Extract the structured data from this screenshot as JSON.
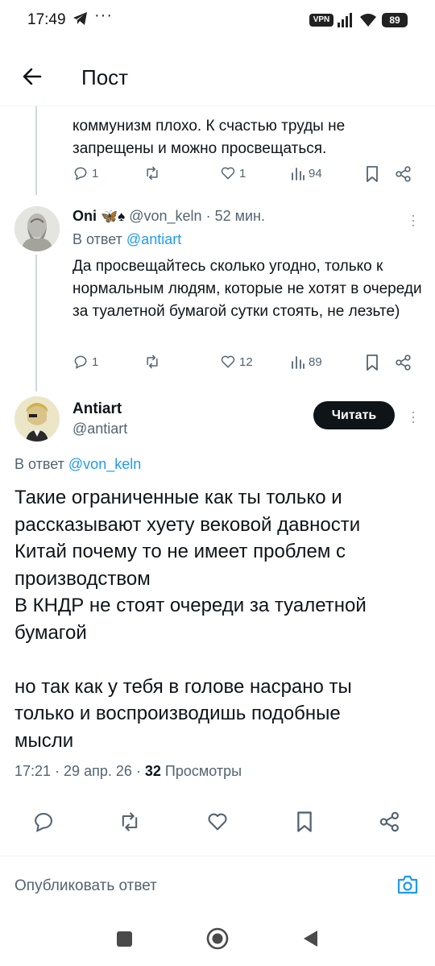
{
  "status_bar": {
    "time": "17:49",
    "dots": "···",
    "vpn": "VPN",
    "battery": "89"
  },
  "header": {
    "title": "Пост"
  },
  "top_tweet": {
    "text_line1": "коммунизм плохо. К счастью труды не",
    "text_line2": "запрещены и можно просвещаться.",
    "replies": "1",
    "likes": "1",
    "views": "94"
  },
  "reply_tweet": {
    "display_name": "Oni",
    "emoji": "🦋♠",
    "handle": "@von_keln",
    "time": "· 52 мин.",
    "reply_to_label": "В ответ",
    "reply_to_handle": "@antiart",
    "text": "Да просвещайтесь сколько угодно, только к нормальным людям, которые не хотят в очереди за туалетной бумагой сутки стоять, не лезьте)",
    "replies": "1",
    "likes": "12",
    "views": "89"
  },
  "main_tweet": {
    "display_name": "Antiart",
    "handle": "@antiart",
    "follow_label": "Читать",
    "reply_to_label": "В ответ",
    "reply_to_handle": "@von_keln",
    "line1": "Такие ограниченные как ты только и",
    "line2": "рассказывают хуету вековой давности",
    "line3": "Китай почему то не имеет проблем с",
    "line4": "производством",
    "line5": "В КНДР не стоят очереди за туалетной",
    "line6": "бумагой",
    "line7": "но так как у тебя в голове насрано ты",
    "line8": "только и воспроизводишь подобные",
    "line9": "мысли",
    "timestamp": "17:21 · 29 апр. 26 ·",
    "views_count": "32",
    "views_label": "Просмотры"
  },
  "reply_composer": {
    "placeholder": "Опубликовать ответ"
  },
  "icons": {
    "back": "arrow-left-icon",
    "reply": "comment-icon",
    "retweet": "retweet-icon",
    "like": "heart-icon",
    "views": "views-bar-icon",
    "bookmark": "bookmark-icon",
    "share": "share-icon",
    "camera": "camera-icon"
  },
  "colors": {
    "accent": "#1d9bf0",
    "text": "#0f1419",
    "muted": "#536471",
    "follow_button": "#0f1419"
  }
}
